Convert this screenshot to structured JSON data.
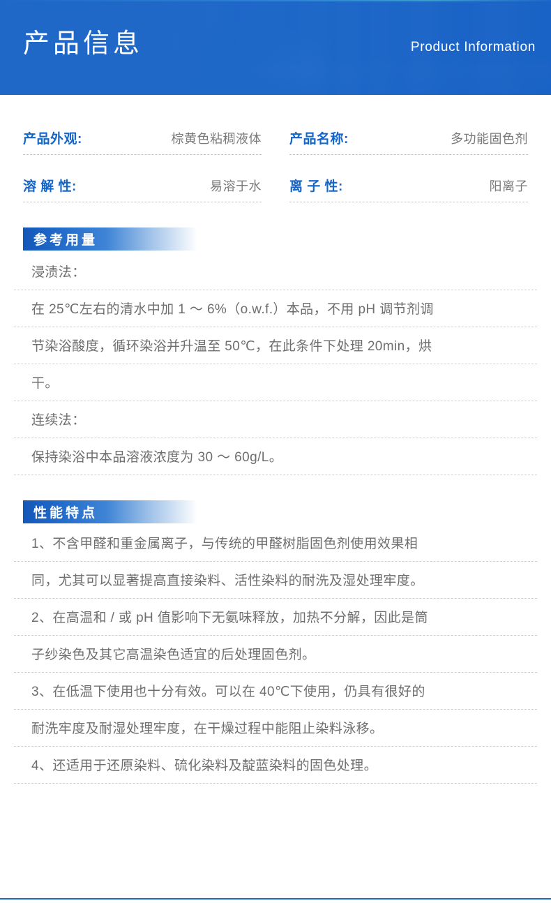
{
  "banner": {
    "title_cn": "产品信息",
    "title_en": "Product Information"
  },
  "properties": [
    {
      "label": "产品外观:",
      "value": "棕黄色粘稠液体"
    },
    {
      "label": "产品名称:",
      "value": "多功能固色剂"
    },
    {
      "label": "溶 解 性:",
      "value": "易溶于水"
    },
    {
      "label": "离 子 性:",
      "value": "阳离子"
    }
  ],
  "sections": [
    {
      "heading": "参考用量",
      "lines": [
        "浸渍法：",
        "在 25℃左右的清水中加 1 ～ 6%（o.w.f.）本品，不用 pH 调节剂调",
        "节染浴酸度，循环染浴并升温至 50℃，在此条件下处理 20min，烘",
        "干。",
        "连续法：",
        "保持染浴中本品溶液浓度为 30 ～ 60g/L。"
      ]
    },
    {
      "heading": "性能特点",
      "lines": [
        "1、不含甲醛和重金属离子，与传统的甲醛树脂固色剂使用效果相",
        "同，尤其可以显著提高直接染料、活性染料的耐洗及湿处理牢度。",
        "2、在高温和 / 或 pH 值影响下无氨味释放，加热不分解，因此是筒",
        "子纱染色及其它高温染色适宜的后处理固色剂。",
        "3、在低温下使用也十分有效。可以在 40℃下使用，仍具有很好的",
        "耐洗牢度及耐湿处理牢度，在干燥过程中能阻止染料泳移。",
        "4、还适用于还原染料、硫化染料及靛蓝染料的固色处理。"
      ]
    }
  ],
  "colors": {
    "brand_blue": "#1f68c8",
    "label_blue": "#1566c9",
    "body_gray": "#6e6e6e",
    "value_gray": "#7a7a7a"
  }
}
